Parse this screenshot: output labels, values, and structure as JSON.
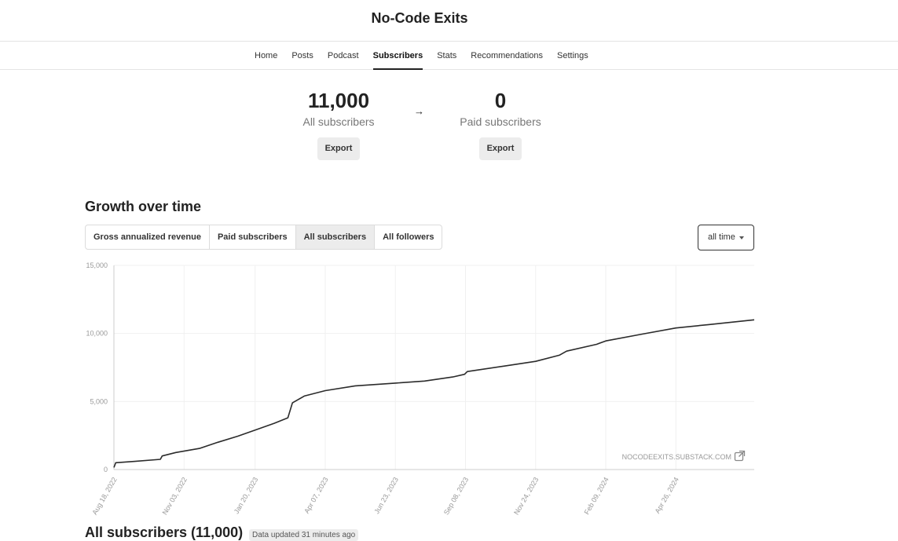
{
  "site": {
    "title": "No-Code Exits"
  },
  "nav": {
    "tabs": [
      {
        "label": "Home"
      },
      {
        "label": "Posts"
      },
      {
        "label": "Podcast"
      },
      {
        "label": "Subscribers"
      },
      {
        "label": "Stats"
      },
      {
        "label": "Recommendations"
      },
      {
        "label": "Settings"
      }
    ],
    "active": "Subscribers"
  },
  "stats": {
    "all": {
      "value": "11,000",
      "label": "All subscribers",
      "button": "Export"
    },
    "paid": {
      "value": "0",
      "label": "Paid subscribers",
      "button": "Export"
    },
    "arrow": "→"
  },
  "growth": {
    "title": "Growth over time",
    "segments": [
      {
        "label": "Gross annualized revenue"
      },
      {
        "label": "Paid subscribers"
      },
      {
        "label": "All subscribers"
      },
      {
        "label": "All followers"
      }
    ],
    "active_segment": "All subscribers",
    "range": {
      "selected": "all time"
    }
  },
  "chart_data": {
    "type": "line",
    "watermark": "NOCODEEXITS.SUBSTACK.COM",
    "ylim": [
      0,
      15000
    ],
    "yticks": [
      0,
      5000,
      10000,
      15000
    ],
    "ytick_labels": [
      "0",
      "5,000",
      "10,000",
      "15,000"
    ],
    "xlim": [
      "2022-08-18",
      "2024-07-21"
    ],
    "xticks": [
      "2022-08-18",
      "2022-11-03",
      "2023-01-20",
      "2023-04-07",
      "2023-06-23",
      "2023-09-08",
      "2023-11-24",
      "2024-02-09",
      "2024-04-26"
    ],
    "xtick_labels": [
      "Aug 18, 2022",
      "Nov 03, 2022",
      "Jan 20, 2023",
      "Apr 07, 2023",
      "Jun 23, 2023",
      "Sep 08, 2023",
      "Nov 24, 2023",
      "Feb 09, 2024",
      "Apr 26, 2024"
    ],
    "grid": true,
    "series": [
      {
        "values": [
          [
            "2022-08-18",
            150
          ],
          [
            "2022-08-20",
            500
          ],
          [
            "2022-09-10",
            600
          ],
          [
            "2022-10-08",
            750
          ],
          [
            "2022-10-10",
            1000
          ],
          [
            "2022-10-25",
            1250
          ],
          [
            "2022-11-20",
            1550
          ],
          [
            "2022-12-10",
            2000
          ],
          [
            "2023-01-01",
            2450
          ],
          [
            "2023-01-20",
            2900
          ],
          [
            "2023-02-10",
            3400
          ],
          [
            "2023-02-25",
            3800
          ],
          [
            "2023-03-02",
            4900
          ],
          [
            "2023-03-15",
            5400
          ],
          [
            "2023-04-07",
            5800
          ],
          [
            "2023-05-10",
            6150
          ],
          [
            "2023-06-23",
            6350
          ],
          [
            "2023-07-25",
            6500
          ],
          [
            "2023-08-25",
            6800
          ],
          [
            "2023-09-07",
            7000
          ],
          [
            "2023-09-10",
            7200
          ],
          [
            "2023-10-20",
            7600
          ],
          [
            "2023-11-24",
            7950
          ],
          [
            "2023-12-20",
            8400
          ],
          [
            "2023-12-28",
            8700
          ],
          [
            "2024-01-30",
            9200
          ],
          [
            "2024-02-09",
            9450
          ],
          [
            "2024-03-20",
            9950
          ],
          [
            "2024-04-26",
            10400
          ],
          [
            "2024-06-01",
            10650
          ],
          [
            "2024-07-21",
            11000
          ]
        ]
      }
    ]
  },
  "subscribers_list": {
    "title": "All subscribers (11,000)",
    "updated": "Data updated 31 minutes ago"
  }
}
